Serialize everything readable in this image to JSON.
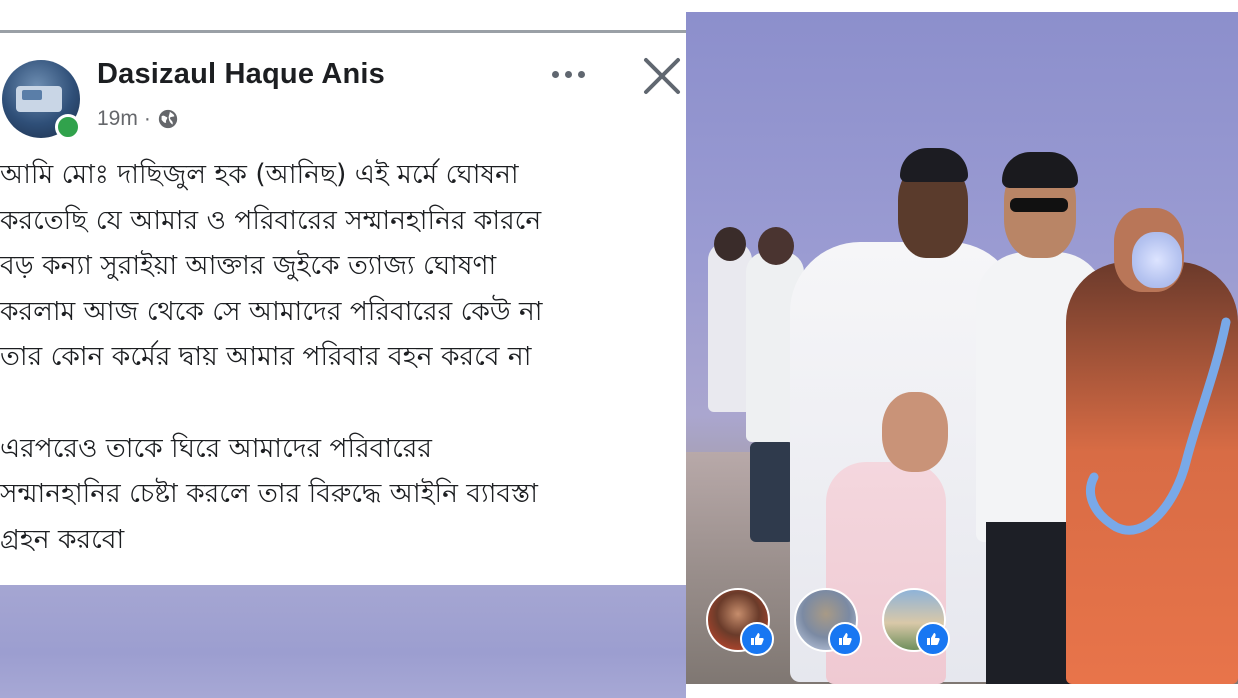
{
  "post": {
    "author_name": "Dasizaul Haque Anis",
    "time": "19m",
    "separator": "·",
    "audience_icon": "globe-icon",
    "more_icon": "more-horizontal-icon",
    "close_icon": "close-icon",
    "online_status_color": "#31a24c",
    "body_lines": [
      "আমি মোঃ দাছিজুল হক (আনিছ) এই মর্মে ঘোষনা",
      "করতেছি যে আমার ও পরিবারের সম্মানহানির কারনে",
      "বড় কন্যা সুরাইয়া আক্তার জুইকে ত্যাজ্য ঘোষণা",
      "করলাম আজ থেকে সে আমাদের পরিবারের কেউ না",
      "তার কোন কর্মের দ্বায় আমার পরিবার বহন করবে না",
      "এরপরেও তাকে ঘিরে আমাদের পরিবারের",
      "সন্মানহানির চেষ্টা করলে তার বিরুদ্ধে আইনি ব্যাবস্তা",
      "গ্রহন করবো"
    ]
  },
  "photo": {
    "reactions": [
      {
        "name": "reactor-1",
        "icon": "like-icon"
      },
      {
        "name": "reactor-2",
        "icon": "like-icon"
      },
      {
        "name": "reactor-3",
        "icon": "like-icon"
      }
    ],
    "like_color": "#1877f2"
  }
}
